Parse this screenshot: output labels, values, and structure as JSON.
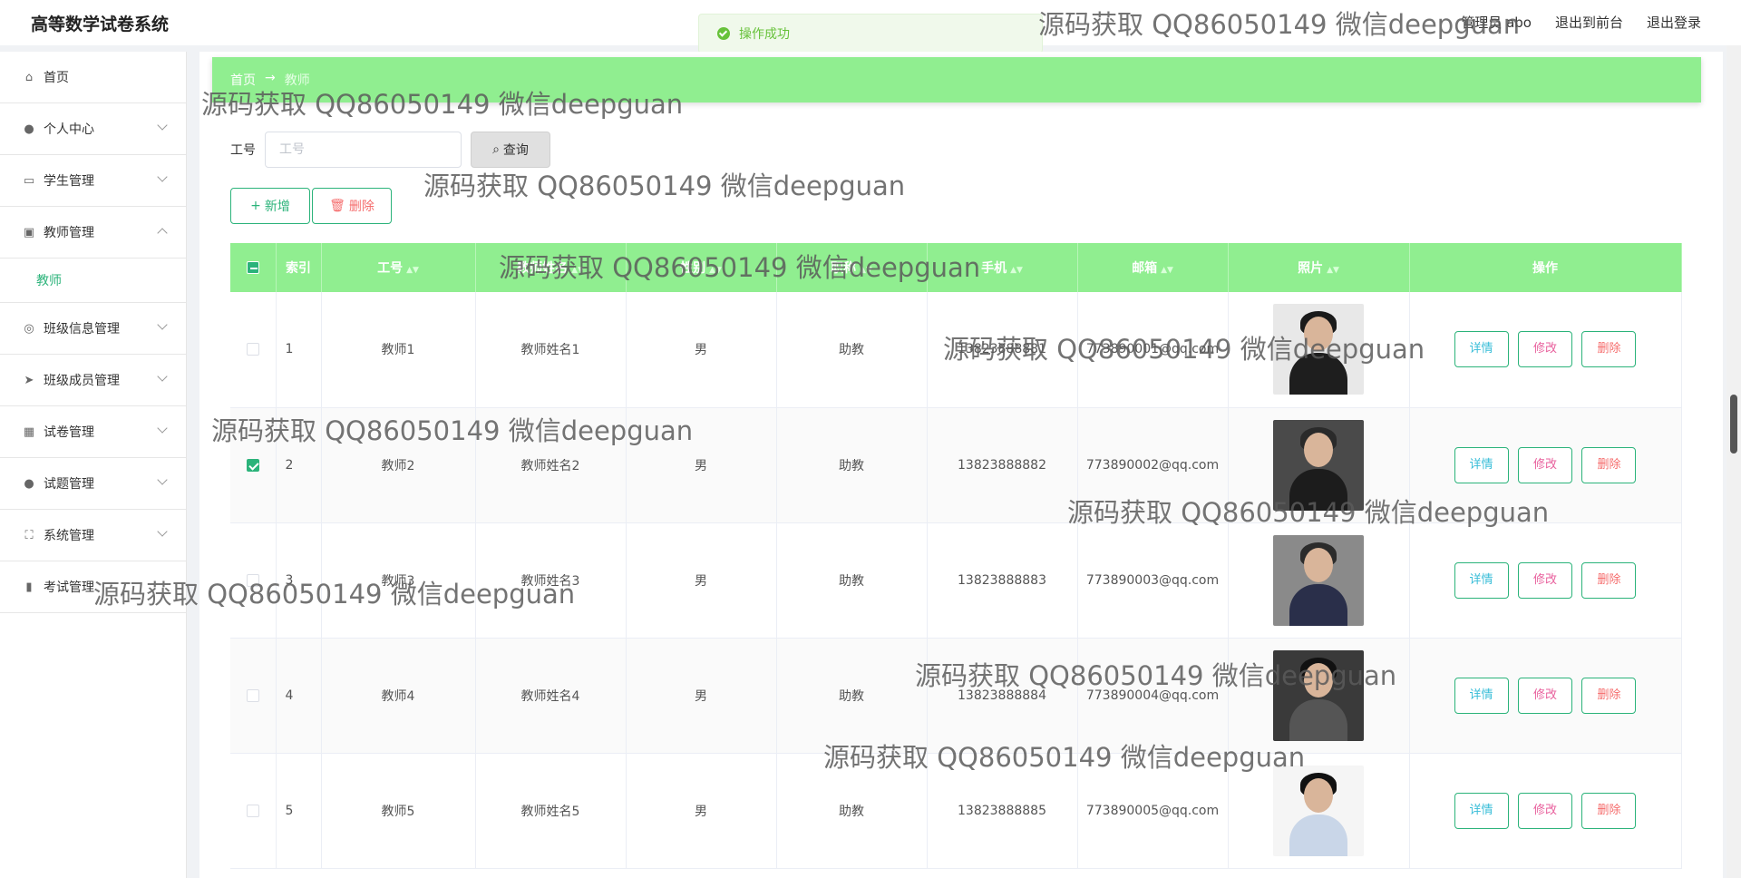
{
  "header": {
    "app_title": "高等数学试卷系统",
    "user_greeting": "管理员 abo",
    "back_to_front": "退出到前台",
    "logout": "退出登录"
  },
  "toast": {
    "message": "操作成功"
  },
  "sidebar": {
    "items": [
      {
        "label": "首页",
        "icon": "home-icon",
        "expanded": null
      },
      {
        "label": "个人中心",
        "icon": "user-icon",
        "expanded": false
      },
      {
        "label": "学生管理",
        "icon": "id-card-icon",
        "expanded": false
      },
      {
        "label": "教师管理",
        "icon": "clipboard-icon",
        "expanded": true
      },
      {
        "label": "班级信息管理",
        "icon": "compass-icon",
        "expanded": false
      },
      {
        "label": "班级成员管理",
        "icon": "send-icon",
        "expanded": false
      },
      {
        "label": "试卷管理",
        "icon": "grid-icon",
        "expanded": false
      },
      {
        "label": "试题管理",
        "icon": "user-icon",
        "expanded": false
      },
      {
        "label": "系统管理",
        "icon": "frame-icon",
        "expanded": false
      },
      {
        "label": "考试管理",
        "icon": "chart-icon",
        "expanded": null
      }
    ],
    "sub_item": "教师"
  },
  "breadcrumb": {
    "home": "首页",
    "separator": "→",
    "current": "教师"
  },
  "search": {
    "label": "工号",
    "placeholder": "工号",
    "value": "",
    "button": "查询"
  },
  "actions": {
    "add": "新增",
    "delete": "删除"
  },
  "table": {
    "headers": [
      "索引",
      "工号",
      "教师姓名",
      "性别",
      "职称",
      "手机",
      "邮箱",
      "照片",
      "操作"
    ],
    "rows": [
      {
        "index": "1",
        "id": "教师1",
        "name": "教师姓名1",
        "gender": "男",
        "title": "助教",
        "phone": "13823888881",
        "email": "773890001@qq.com",
        "checked": false
      },
      {
        "index": "2",
        "id": "教师2",
        "name": "教师姓名2",
        "gender": "男",
        "title": "助教",
        "phone": "13823888882",
        "email": "773890002@qq.com",
        "checked": true
      },
      {
        "index": "3",
        "id": "教师3",
        "name": "教师姓名3",
        "gender": "男",
        "title": "助教",
        "phone": "13823888883",
        "email": "773890003@qq.com",
        "checked": false
      },
      {
        "index": "4",
        "id": "教师4",
        "name": "教师姓名4",
        "gender": "男",
        "title": "助教",
        "phone": "13823888884",
        "email": "773890004@qq.com",
        "checked": false
      },
      {
        "index": "5",
        "id": "教师5",
        "name": "教师姓名5",
        "gender": "男",
        "title": "助教",
        "phone": "13823888885",
        "email": "773890005@qq.com",
        "checked": false
      }
    ],
    "row_actions": {
      "detail": "详情",
      "edit": "修改",
      "remove": "删除"
    }
  },
  "watermark": "源码获取 QQ86050149 微信deepguan",
  "colors": {
    "accent": "#90ee90",
    "primary": "#2bb37a",
    "danger": "#f56c6c",
    "info": "#38bdd8",
    "edit": "#e85f9c"
  }
}
